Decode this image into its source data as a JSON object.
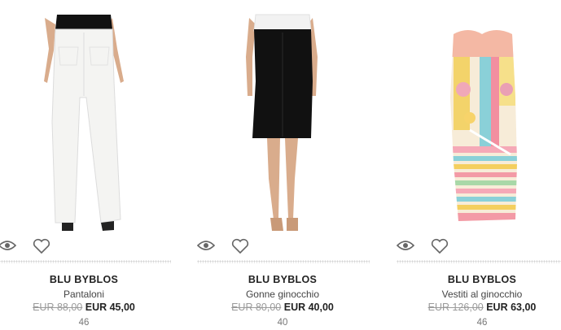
{
  "products": [
    {
      "brand": "BLU BYBLOS",
      "category": "Pantaloni",
      "old_price": "EUR 88,00",
      "new_price": "EUR 45,00",
      "size": "46"
    },
    {
      "brand": "BLU BYBLOS",
      "category": "Gonne ginocchio",
      "old_price": "EUR 80,00",
      "new_price": "EUR 40,00",
      "size": "40"
    },
    {
      "brand": "BLU BYBLOS",
      "category": "Vestiti al ginocchio",
      "old_price": "EUR 126,00",
      "new_price": "EUR 63,00",
      "size": "46"
    }
  ],
  "icons": {
    "quick_view": "eye-icon",
    "wishlist": "heart-icon"
  },
  "colors": {
    "old_price": "#9a9a9a",
    "text": "#222222"
  }
}
